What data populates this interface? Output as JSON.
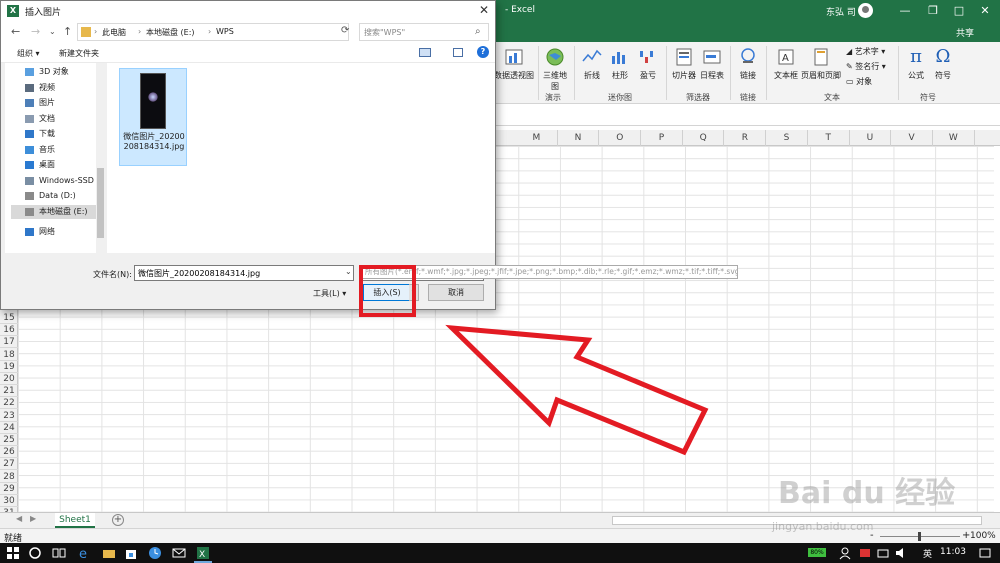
{
  "excel": {
    "title_suffix": "- Excel",
    "user_name": "东弘 司",
    "share_label": "共享",
    "window_buttons": [
      "—",
      "❐",
      "□",
      "✕"
    ],
    "ribbon": {
      "pivot_chart": "数据透视图",
      "map3d": "三维地图",
      "map3d_group": "演示",
      "sparkline_line": "折线",
      "sparkline_column": "柱形",
      "sparkline_winloss": "盈亏",
      "sparkline_group": "迷你图",
      "slicer": "切片器",
      "timeline": "日程表",
      "filter_group": "筛选器",
      "link": "链接",
      "link_group": "链接",
      "textbox": "文本框",
      "header_footer": "页眉和页脚",
      "wordart": "艺术字",
      "signature": "签名行",
      "object": "对象",
      "text_group": "文本",
      "equation": "公式",
      "symbol": "符号",
      "symbol_group": "符号"
    },
    "columns": [
      "M",
      "N",
      "O",
      "P",
      "Q",
      "R",
      "S",
      "T",
      "U",
      "V",
      "W"
    ],
    "rows": [
      "15",
      "16",
      "17",
      "18",
      "19",
      "20",
      "21",
      "22",
      "23",
      "24",
      "25",
      "26",
      "27",
      "28",
      "29",
      "30",
      "31"
    ],
    "sheet_tab": "Sheet1",
    "add_sheet": "+",
    "status_ready": "就绪",
    "zoom_minus": "-",
    "zoom_plus": "+",
    "zoom": "100%"
  },
  "dialog": {
    "title": "插入图片",
    "close": "✕",
    "nav_back": "←",
    "nav_forward": "→",
    "nav_recent": "⌄",
    "nav_up": "↑",
    "breadcrumb": [
      "此电脑",
      "本地磁盘 (E:)",
      "WPS"
    ],
    "breadcrumb_sep": "›",
    "refresh": "⟳",
    "search_placeholder": "搜索\"WPS\"",
    "toolbar": {
      "organize": "组织 ▾",
      "new_folder": "新建文件夹",
      "help": "?"
    },
    "nav_items": [
      {
        "label": "3D 对象",
        "color": "#5aa0e0"
      },
      {
        "label": "视频",
        "color": "#5b6b7e"
      },
      {
        "label": "图片",
        "color": "#4d7fb8"
      },
      {
        "label": "文档",
        "color": "#8a9bb0"
      },
      {
        "label": "下载",
        "color": "#2f77c9"
      },
      {
        "label": "音乐",
        "color": "#3d8ed9"
      },
      {
        "label": "桌面",
        "color": "#2a7ad1"
      },
      {
        "label": "Windows-SSD (",
        "color": "#7a8ea3"
      },
      {
        "label": "Data (D:)",
        "color": "#8a8a8a"
      },
      {
        "label": "本地磁盘 (E:)",
        "color": "#8a8a8a"
      },
      {
        "label": "网络",
        "color": "#2f77c9"
      }
    ],
    "file": {
      "name": "微信图片_20200208184314.jpg"
    },
    "filename_label": "文件名(N):",
    "filename_value": "微信图片_20200208184314.jpg",
    "filename_dropdown": "⌄",
    "filter_tip": "所有图片(*.emf;*.wmf;*.jpg;*.jpeg;*.jfif;*.jpe;*.png;*.bmp;*.dib;*.rle;*.gif;*.emz;*.wmz;*.tif;*.tiff;*.svg)",
    "tools_label": "工具(L)",
    "tools_arrow": "▾",
    "insert_label": "插入(S)",
    "insert_arrow": "▾",
    "cancel_label": "取消"
  },
  "watermark": {
    "brand": "Bai du 经验",
    "url": "jingyan.baidu.com"
  },
  "taskbar": {
    "battery": "80%",
    "ime": "英",
    "time": "11:03"
  },
  "colors": {
    "excel_green": "#217346",
    "annotation_red": "#e31b23",
    "accent_blue": "#0078d7"
  }
}
